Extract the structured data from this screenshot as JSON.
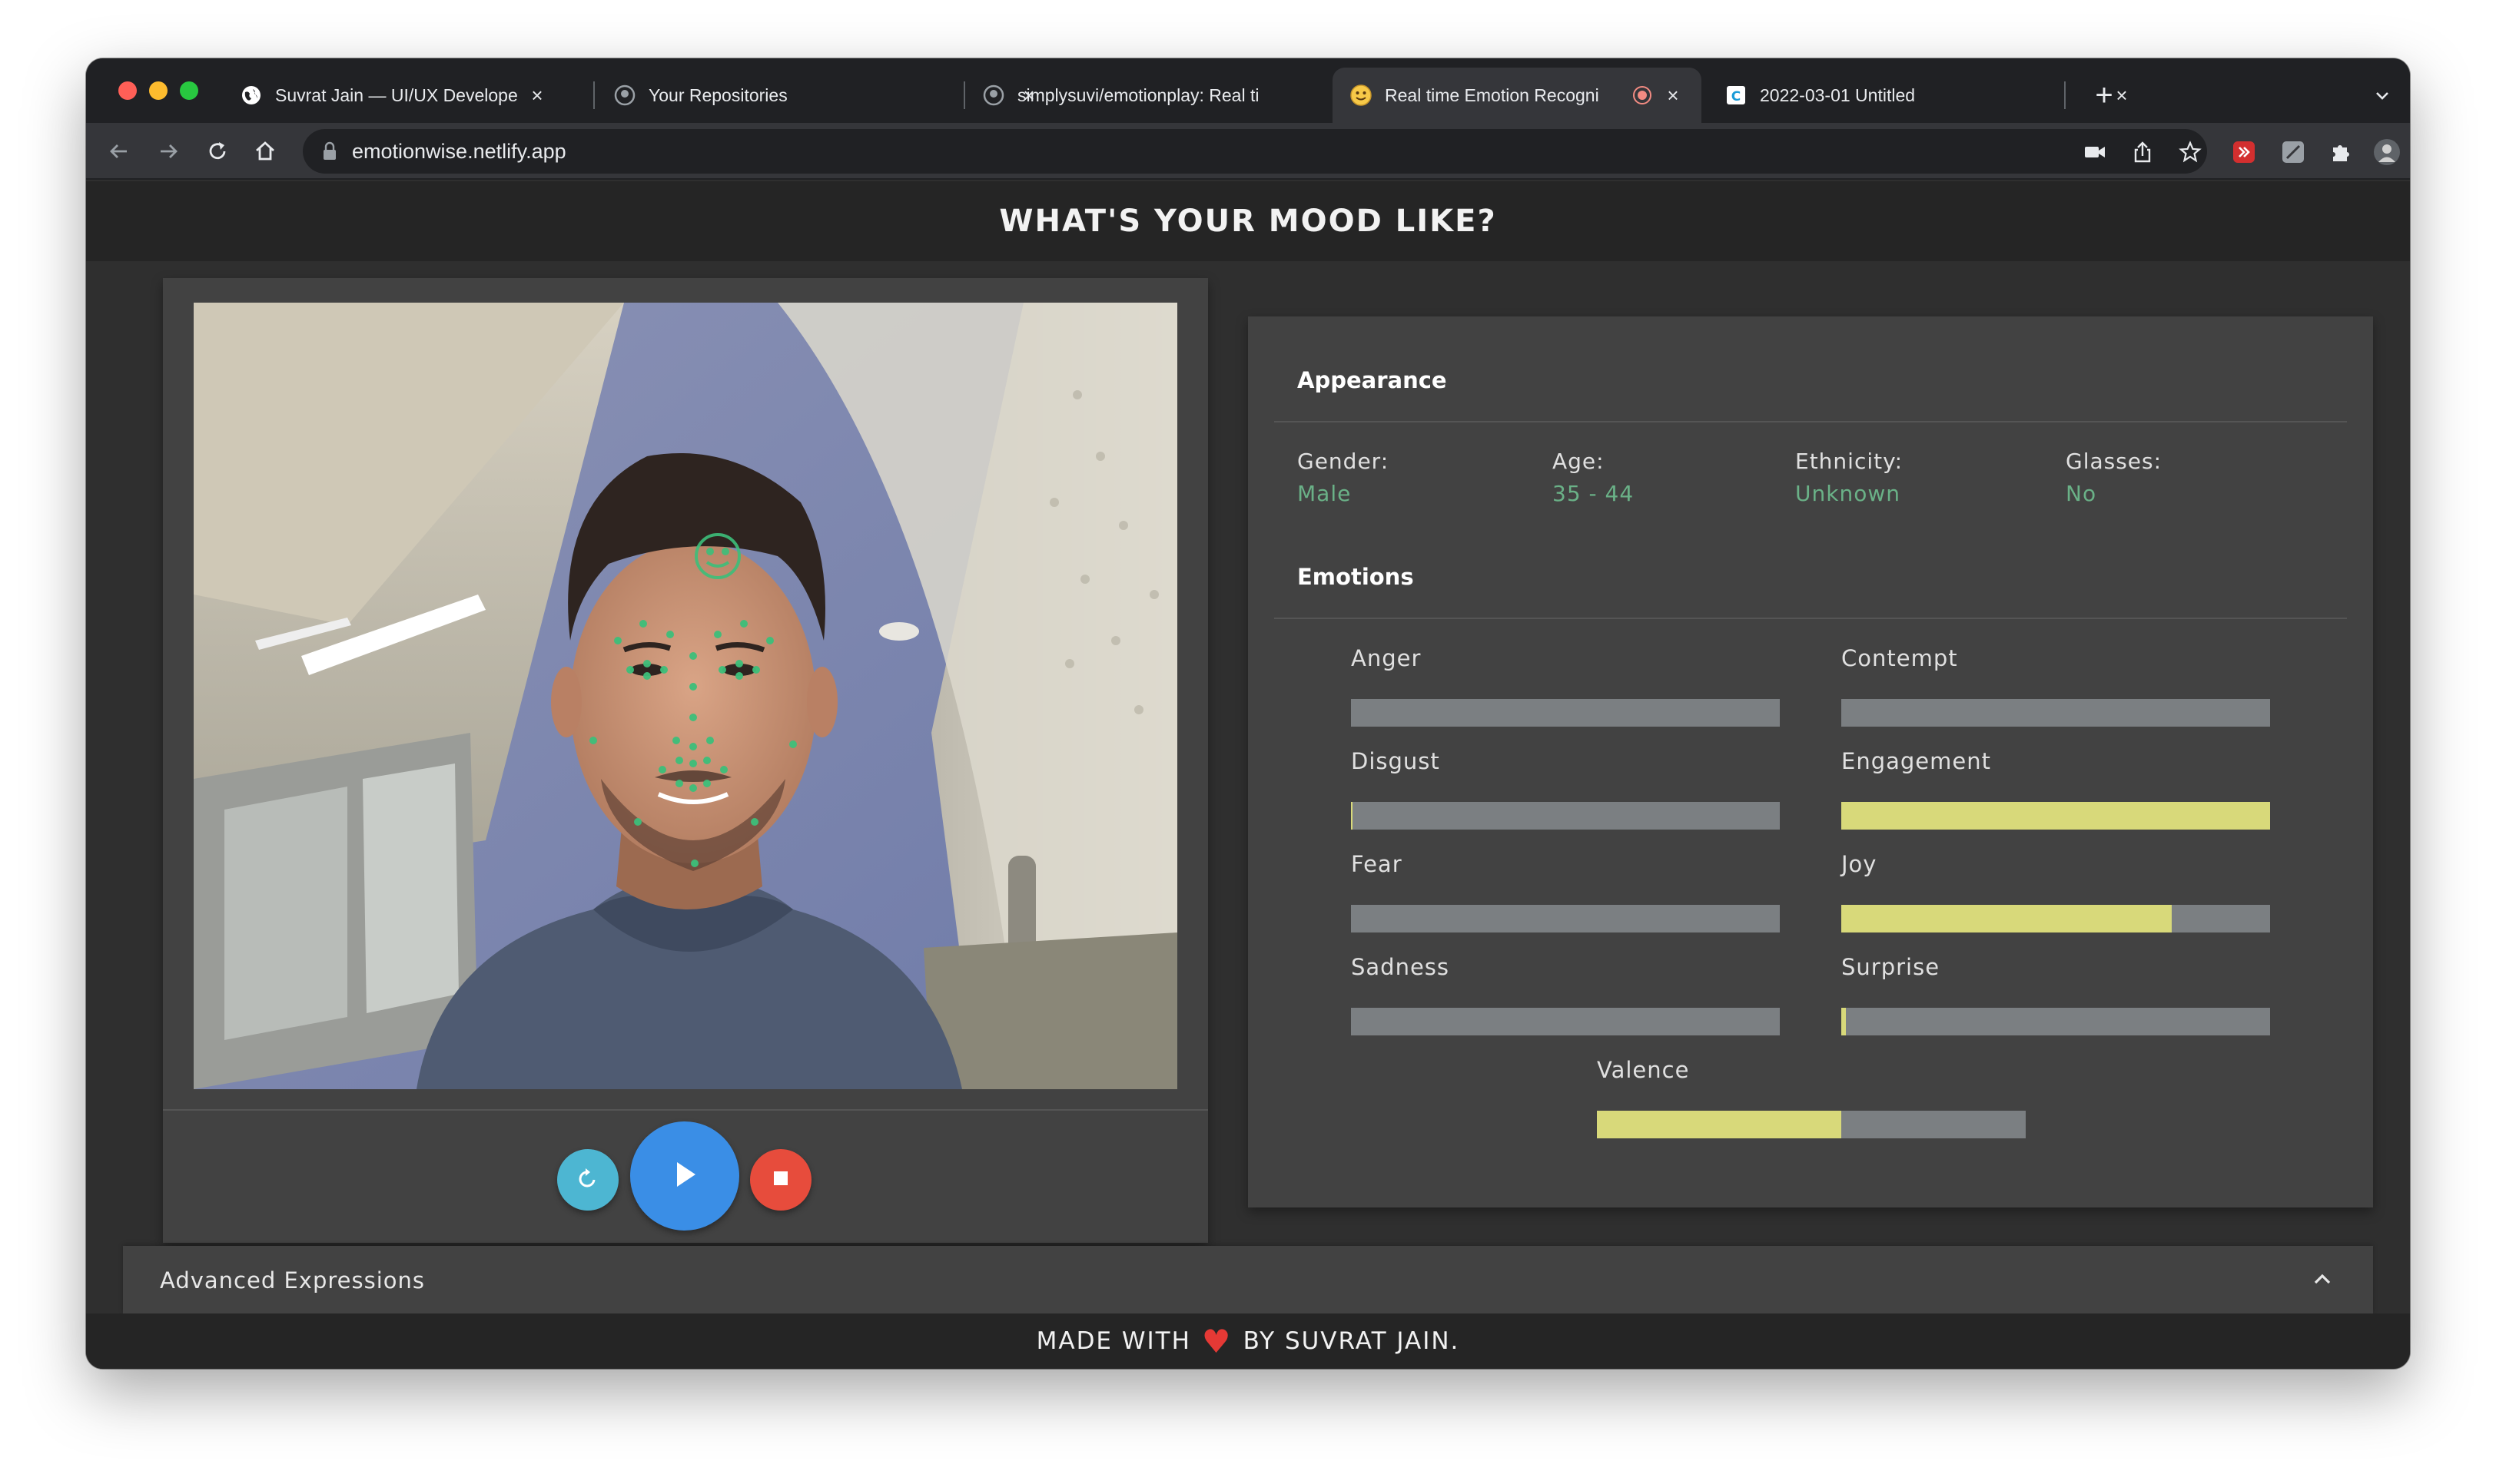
{
  "browser": {
    "tabs": [
      {
        "title": "Suvrat Jain — UI/UX Developer",
        "favicon": "globe-icon",
        "active": false
      },
      {
        "title": "Your Repositories",
        "favicon": "github-icon",
        "active": false
      },
      {
        "title": "simplysuvi/emotionplay: Real ti",
        "favicon": "github-icon",
        "active": false
      },
      {
        "title": "Real time Emotion Recogni",
        "favicon": "emoji-icon",
        "active": true,
        "recording": true
      },
      {
        "title": "2022-03-01 Untitled",
        "favicon": "doc-icon",
        "active": false
      }
    ],
    "url": "emotionwise.netlify.app"
  },
  "page": {
    "title": "WHAT'S YOUR MOOD LIKE?"
  },
  "appearance": {
    "heading": "Appearance",
    "fields": [
      {
        "label": "Gender:",
        "value": "Male"
      },
      {
        "label": "Age:",
        "value": "35 - 44"
      },
      {
        "label": "Ethnicity:",
        "value": "Unknown"
      },
      {
        "label": "Glasses:",
        "value": "No"
      }
    ]
  },
  "emotions": {
    "heading": "Emotions",
    "items": [
      {
        "label": "Anger",
        "value": 0
      },
      {
        "label": "Contempt",
        "value": 0
      },
      {
        "label": "Disgust",
        "value": 0.004
      },
      {
        "label": "Engagement",
        "value": 1.0
      },
      {
        "label": "Fear",
        "value": 0
      },
      {
        "label": "Joy",
        "value": 0.77
      },
      {
        "label": "Sadness",
        "value": 0
      },
      {
        "label": "Surprise",
        "value": 0.01
      }
    ],
    "valence": {
      "label": "Valence",
      "value": 0.57
    }
  },
  "advanced": {
    "label": "Advanced Expressions"
  },
  "footer": {
    "before": "MADE WITH",
    "heart": "♥",
    "after": "BY SUVRAT JAIN."
  },
  "colors": {
    "accent_green": "#6ab187",
    "bar_fill": "#d8d97a",
    "bar_track": "#7b7f82",
    "play": "#3a8ee6",
    "reset": "#4db6d2",
    "stop": "#e74c3c"
  }
}
